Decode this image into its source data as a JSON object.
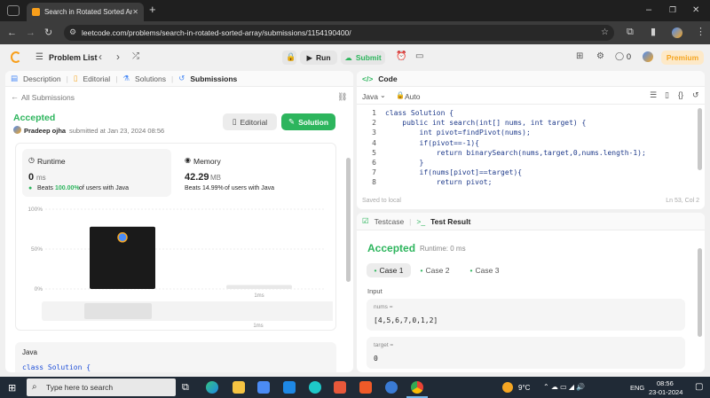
{
  "browser": {
    "tab_title": "Search in Rotated Sorted Array",
    "tab_close": "✕",
    "new_tab": "+",
    "url": "leetcode.com/problems/search-in-rotated-sorted-array/submissions/1154190400/",
    "window_controls": [
      "–",
      "❐",
      "✕"
    ]
  },
  "appbar": {
    "problem_list": "Problem List",
    "run": "Run",
    "submit": "Submit",
    "notifications": "0",
    "premium": "Premium"
  },
  "left_tabs": [
    "Description",
    "Editorial",
    "Solutions",
    "Submissions"
  ],
  "submission": {
    "back": "All Submissions",
    "status": "Accepted",
    "author": "Pradeep ojha",
    "submitted_text": "submitted at Jan 23, 2024 08:56",
    "editorial_btn": "Editorial",
    "solution_btn": "Solution",
    "runtime_label": "Runtime",
    "runtime_value": "0",
    "runtime_unit": "ms",
    "runtime_beats_prefix": "Beats",
    "runtime_beats": "100.00%",
    "runtime_beats_suffix": "of users with Java",
    "memory_label": "Memory",
    "memory_value": "42.29",
    "memory_unit": "MB",
    "memory_beats_prefix": "Beats",
    "memory_beats": "14.99%",
    "memory_beats_suffix": "of users with Java",
    "code_lang": "Java",
    "code_preview": "class Solution {"
  },
  "chart_data": {
    "type": "bar",
    "y_ticks": [
      "100%",
      "50%",
      "0%"
    ],
    "ylim": [
      0,
      100
    ],
    "categories": [
      "0ms",
      "1ms"
    ],
    "x_tick_labels": [
      "1ms",
      "1ms"
    ],
    "values": [
      78,
      5
    ],
    "colors": [
      "#1a1a1a",
      "#e8e8e8"
    ]
  },
  "code_panel": {
    "title": "Code",
    "language": "Java",
    "mode": "Auto",
    "lines": [
      "class Solution {",
      "    public int search(int[] nums, int target) {",
      "        int pivot=findPivot(nums);",
      "        if(pivot==-1){",
      "            return binarySearch(nums,target,0,nums.length-1);",
      "        }",
      "        if(nums[pivot]==target){",
      "            return pivot;"
    ],
    "saved": "Saved to local",
    "cursor": "Ln 53, Col 2"
  },
  "result_panel": {
    "testcase_tab": "Testcase",
    "result_tab": "Test Result",
    "status": "Accepted",
    "runtime": "Runtime: 0 ms",
    "cases": [
      "Case 1",
      "Case 2",
      "Case 3"
    ],
    "input_label": "Input",
    "nums_label": "nums =",
    "nums_value": "[4,5,6,7,0,1,2]",
    "target_label": "target =",
    "target_value": "0"
  },
  "taskbar": {
    "search_placeholder": "Type here to search",
    "weather": "9°C",
    "lang": "ENG",
    "time": "08:56",
    "date": "23-01-2024"
  }
}
